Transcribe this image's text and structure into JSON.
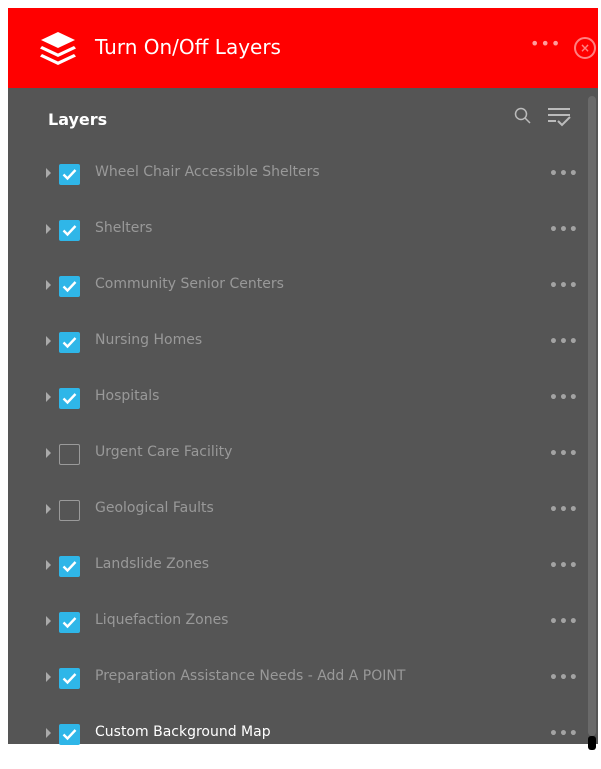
{
  "header": {
    "title": "Turn On/Off Layers",
    "more_label": "•••",
    "close_label": "×"
  },
  "layers_section": {
    "title": "Layers"
  },
  "layers": [
    {
      "name": "Wheel Chair Accessible Shelters",
      "checked": true
    },
    {
      "name": "Shelters",
      "checked": true
    },
    {
      "name": "Community Senior Centers",
      "checked": true
    },
    {
      "name": "Nursing Homes",
      "checked": true
    },
    {
      "name": "Hospitals",
      "checked": true
    },
    {
      "name": "Urgent Care Facility",
      "checked": false
    },
    {
      "name": "Geological Faults",
      "checked": false
    },
    {
      "name": "Landslide Zones",
      "checked": true
    },
    {
      "name": "Liquefaction Zones",
      "checked": true
    },
    {
      "name": "Preparation Assistance Needs - Add A POINT",
      "checked": true
    },
    {
      "name": "Custom Background Map",
      "checked": true
    }
  ],
  "row_menu_label": "•••",
  "colors": {
    "header_bg": "#ff0000",
    "panel_bg": "#555555",
    "checkbox_on": "#2fb6e8"
  }
}
